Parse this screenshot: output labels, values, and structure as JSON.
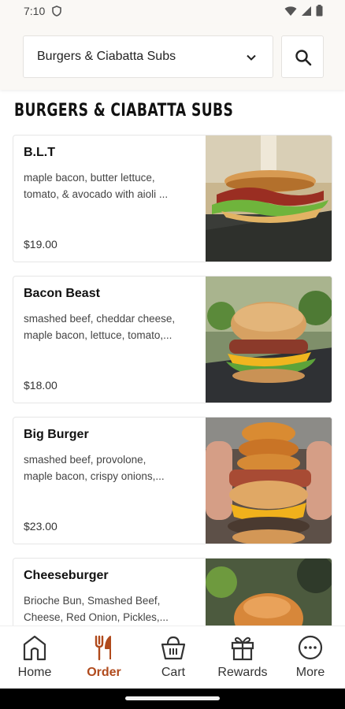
{
  "status_bar": {
    "time": "7:10"
  },
  "category_selector": {
    "selected": "Burgers & Ciabatta Subs"
  },
  "section": {
    "title": "BURGERS & CIABATTA SUBS"
  },
  "items": [
    {
      "name": "B.L.T",
      "desc_line1": "maple bacon, butter lettuce,",
      "desc_line2": "tomato, & avocado with aioli ...",
      "price": "$19.00"
    },
    {
      "name": "Bacon Beast",
      "desc_line1": "smashed beef, cheddar cheese,",
      "desc_line2": "maple bacon, lettuce, tomato,...",
      "price": "$18.00"
    },
    {
      "name": "Big Burger",
      "desc_line1": "smashed beef, provolone,",
      "desc_line2": "maple bacon, crispy onions,...",
      "price": "$23.00"
    },
    {
      "name": "Cheeseburger",
      "desc_line1": "Brioche Bun, Smashed Beef,",
      "desc_line2": "Cheese, Red Onion, Pickles,...",
      "price": ""
    }
  ],
  "bottom_nav": {
    "active": "order",
    "accent_color": "#b04a1c",
    "items": [
      {
        "id": "home",
        "label": "Home",
        "icon": "home-icon"
      },
      {
        "id": "order",
        "label": "Order",
        "icon": "fork-knife-icon"
      },
      {
        "id": "cart",
        "label": "Cart",
        "icon": "basket-icon"
      },
      {
        "id": "rewards",
        "label": "Rewards",
        "icon": "gift-icon"
      },
      {
        "id": "more",
        "label": "More",
        "icon": "more-dots-icon"
      }
    ]
  }
}
